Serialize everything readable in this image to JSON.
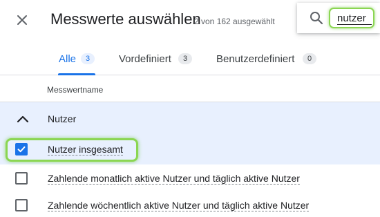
{
  "header": {
    "close_icon": "close-icon",
    "title": "Messwerte auswählen",
    "subtitle": "2 von 162 ausgewählt"
  },
  "search": {
    "icon": "search-icon",
    "value": "nutzer",
    "highlight_color": "#8bd652"
  },
  "tabs": [
    {
      "label": "Alle",
      "count": "3",
      "active": true
    },
    {
      "label": "Vordefiniert",
      "count": "3",
      "active": false
    },
    {
      "label": "Benutzerdefiniert",
      "count": "0",
      "active": false
    }
  ],
  "table": {
    "column_header": "Messwertname",
    "group": {
      "label": "Nutzer",
      "expanded": true,
      "icon": "chevron-up-icon"
    },
    "rows": [
      {
        "label": "Nutzer insgesamt",
        "checked": true
      },
      {
        "label": "Zahlende monatlich aktive Nutzer und täglich aktive Nutzer",
        "checked": false
      },
      {
        "label": "Zahlende wöchentlich aktive Nutzer und täglich aktive Nutzer",
        "checked": false
      }
    ]
  },
  "colors": {
    "accent": "#1a73e8",
    "selected_row_bg": "#e8f0fe",
    "highlight": "#8bd652"
  }
}
